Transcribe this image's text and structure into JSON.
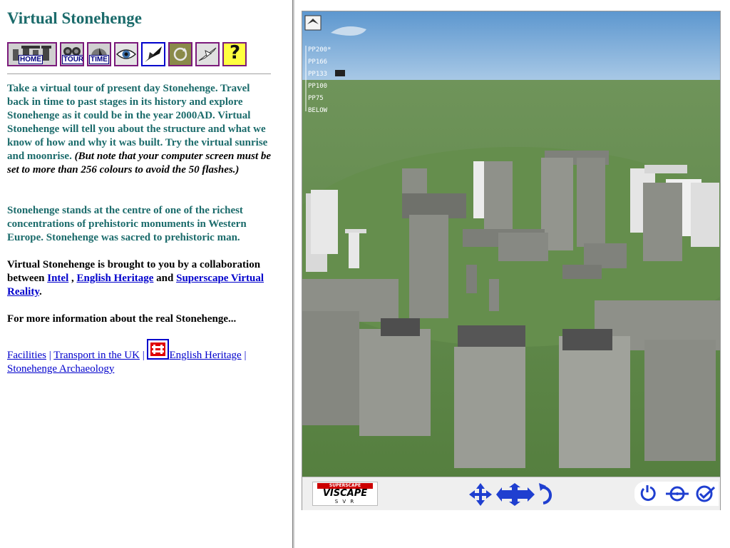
{
  "page": {
    "title": "Virtual Stonehenge"
  },
  "nav": {
    "home_label": "HOME",
    "tour_label": "TOUR",
    "time_label": "TIME",
    "help_glyph": "?"
  },
  "intro": {
    "p1_main": "Take a virtual tour of present day Stonehenge. Travel back in time to past stages in its history and explore Stonehenge as it could be in the year 2000AD. Virtual Stonehenge will tell you about the structure and what we know of how and why it was built. Try the virtual sunrise and moonrise. ",
    "p1_note": "(But note that your computer screen must be set to more than 256 colours to avoid the 50 flashes.)",
    "p2": "Stonehenge stands at the centre of one of the richest concentrations of prehistoric monuments in Western Europe. Stonehenge was sacred to prehistoric man.",
    "p3_prefix": "Virtual Stonehenge is brought to you by a collaboration between ",
    "intel": "Intel",
    "comma": " , ",
    "english_heritage": "English Heritage",
    "and": " and ",
    "superscape": "Superscape Virtual Reality",
    "period": ".",
    "p4": "For more information about the real Stonehenge..."
  },
  "links": {
    "facilities": "Facilities",
    "sep": " | ",
    "transport": "Transport in the UK",
    "english_heritage": "English Heritage",
    "archaeology": "Stonehenge Archaeology"
  },
  "viewer": {
    "lod_levels": [
      "PP200*",
      "PP166",
      "PP133",
      "PP100",
      "PP75",
      "BELOW"
    ],
    "brand_top": "SUPERSCAPE",
    "brand_main": "VISCAPE",
    "brand_sub": "S V R"
  },
  "colors": {
    "title_teal": "#1b6b6b",
    "link_blue": "#0000cc",
    "nav_border": "#7b1a7b",
    "sky": "#6ea3d4",
    "grass": "#5f8a48",
    "control_blue": "#1f3fd0"
  }
}
